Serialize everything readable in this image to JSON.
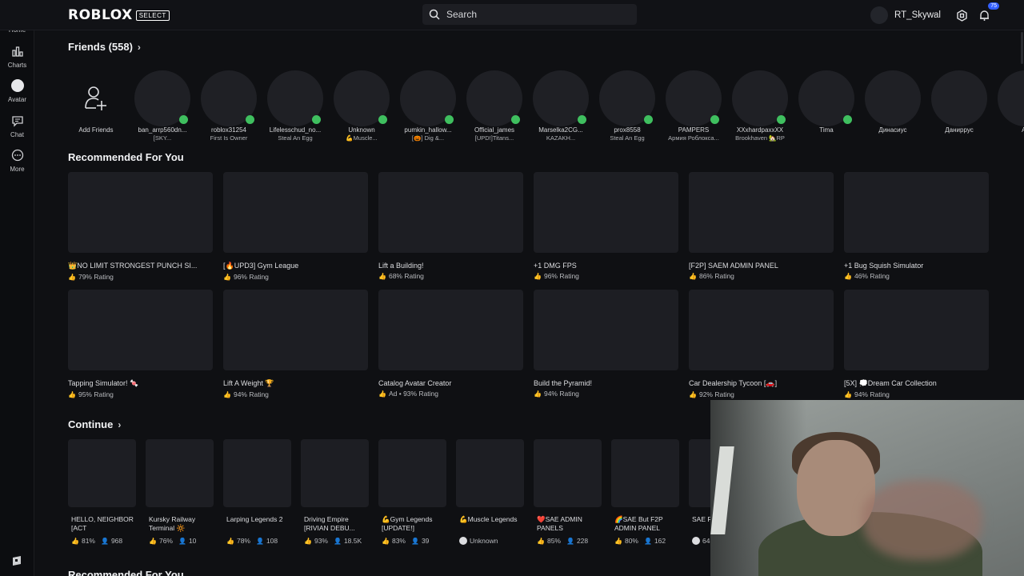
{
  "topbar": {
    "logo": "ROBLOX",
    "logo_badge": "SELECT",
    "search_placeholder": "Search",
    "username": "RT_Skywal",
    "notifications": "75"
  },
  "sidebar": [
    {
      "label": "Home",
      "icon": "home-icon"
    },
    {
      "label": "Charts",
      "icon": "charts-icon"
    },
    {
      "label": "Avatar",
      "icon": "avatar-icon"
    },
    {
      "label": "Chat",
      "icon": "chat-icon"
    },
    {
      "label": "More",
      "icon": "more-icon"
    }
  ],
  "friends": {
    "title": "Friends (558)",
    "add_label": "Add Friends",
    "items": [
      {
        "name": "ban_arrp560dn...",
        "status": "[SKY...",
        "online": true
      },
      {
        "name": "roblox31254",
        "status": "First Is Owner",
        "online": true
      },
      {
        "name": "Lifelesschud_no...",
        "status": "Steal An Egg",
        "online": true
      },
      {
        "name": "Unknown",
        "status": "💪Muscle...",
        "online": true
      },
      {
        "name": "pumkin_hallow...",
        "status": "[🎃] Dig &...",
        "online": true
      },
      {
        "name": "Official_james",
        "status": "[UPD!]Titans...",
        "online": true
      },
      {
        "name": "Marselka2CG...",
        "status": "KAZAKH...",
        "online": true
      },
      {
        "name": "prox8558",
        "status": "Steal An Egg",
        "online": true
      },
      {
        "name": "PAMPERS",
        "status": "Армия Роблокса...",
        "online": true
      },
      {
        "name": "XXxhardpaxxXX",
        "status": "Brookhaven 🏡RP",
        "online": true
      },
      {
        "name": "Tima",
        "status": "",
        "online": true
      },
      {
        "name": "Динасиус",
        "status": "",
        "online": false
      },
      {
        "name": "Даниррус",
        "status": "",
        "online": false
      },
      {
        "name": "An",
        "status": "",
        "online": false
      }
    ]
  },
  "recommended": {
    "title": "Recommended For You",
    "row1": [
      {
        "name": "👑NO LIMIT STRONGEST PUNCH SI...",
        "meta": "79% Rating"
      },
      {
        "name": "[🔥UPD3] Gym League",
        "meta": "96% Rating"
      },
      {
        "name": "Lift a Building!",
        "meta": "68% Rating"
      },
      {
        "name": "+1 DMG FPS",
        "meta": "96% Rating"
      },
      {
        "name": "[F2P] SAEM ADMIN PANEL",
        "meta": "86% Rating"
      },
      {
        "name": "+1 Bug Squish Simulator",
        "meta": "46% Rating"
      }
    ],
    "row2": [
      {
        "name": "Tapping Simulator! 🍬",
        "meta": "95% Rating"
      },
      {
        "name": "Lift A Weight 🏆",
        "meta": "94% Rating"
      },
      {
        "name": "Catalog Avatar Creator",
        "meta": "Ad • 93% Rating"
      },
      {
        "name": "Build the Pyramid!",
        "meta": "94% Rating"
      },
      {
        "name": "Car Dealership Tycoon [🚗]",
        "meta": "92% Rating"
      },
      {
        "name": "[5X] 💭Dream Car Collection",
        "meta": "94% Rating"
      }
    ]
  },
  "continue": {
    "title": "Continue",
    "items": [
      {
        "name": "HELLO, NEIGHBOR [ACT",
        "rating": "81%",
        "players": "968"
      },
      {
        "name": "Kursky Railway Terminal 🔆",
        "rating": "76%",
        "players": "10"
      },
      {
        "name": "Larping Legends 2",
        "rating": "78%",
        "players": "108"
      },
      {
        "name": "Driving Empire [RIVIAN DEBU...",
        "rating": "93%",
        "players": "18.5K"
      },
      {
        "name": "💪Gym Legends [UPDATE!]",
        "rating": "83%",
        "players": "39"
      },
      {
        "name": "💪Muscle Legends",
        "rating": "",
        "players": "Unknown"
      },
      {
        "name": "❤️SAE ADMIN PANELS",
        "rating": "85%",
        "players": "228"
      },
      {
        "name": "🌈SAE But F2P ADMIN PANEL",
        "rating": "80%",
        "players": "162"
      },
      {
        "name": "SAE RBXL",
        "rating": "",
        "players": "64"
      }
    ]
  },
  "recommended_bottom_title": "Recommended For You"
}
